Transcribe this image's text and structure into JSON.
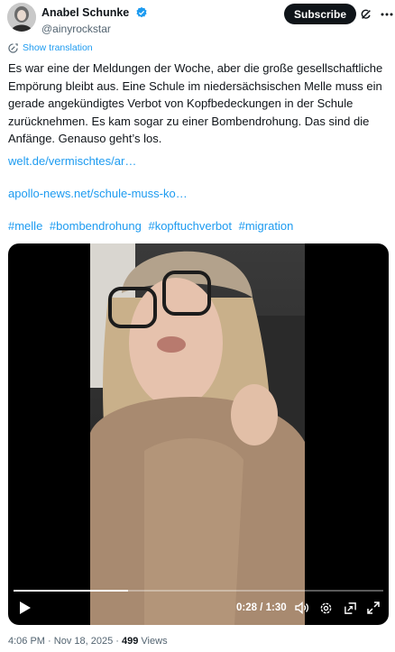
{
  "author": {
    "display_name": "Anabel Schunke",
    "handle": "@ainyrockstar",
    "verified": true
  },
  "header": {
    "subscribe_label": "Subscribe",
    "grok_icon": "grok-icon",
    "more_icon": "more-icon"
  },
  "translation": {
    "label": "Show translation",
    "icon": "translate-icon"
  },
  "tweet": {
    "text": "Es war eine der Meldungen der Woche, aber die große gesellschaftliche Empörung bleibt aus. Eine Schule im niedersächsischen Melle muss ein gerade angekündigtes Verbot von Kopfbedeckungen in der Schule zurücknehmen. Es kam sogar zu einer Bombendrohung. Das sind die Anfänge. Genauso geht’s los.",
    "link1": "welt.de/vermischtes/ar…",
    "link2": "apollo-news.net/schule-muss-ko…",
    "hashtags": [
      "#melle",
      "#bombendrohung",
      "#kopftuchverbot",
      "#migration"
    ]
  },
  "video": {
    "current_time": "0:28",
    "duration": "1:30",
    "time_display": "0:28 / 1:30",
    "progress_fraction": 0.31,
    "controls": [
      "play-icon",
      "volume-icon",
      "settings-icon",
      "pip-icon",
      "fullscreen-icon"
    ]
  },
  "meta": {
    "time": "4:06 PM",
    "date": "Nov 18, 2025",
    "views_count": "499",
    "views_label": "Views",
    "sep": "·"
  },
  "colors": {
    "link": "#1d9bf0",
    "text": "#0f1419",
    "muted": "#536471",
    "subscribe_bg": "#0f1419"
  }
}
